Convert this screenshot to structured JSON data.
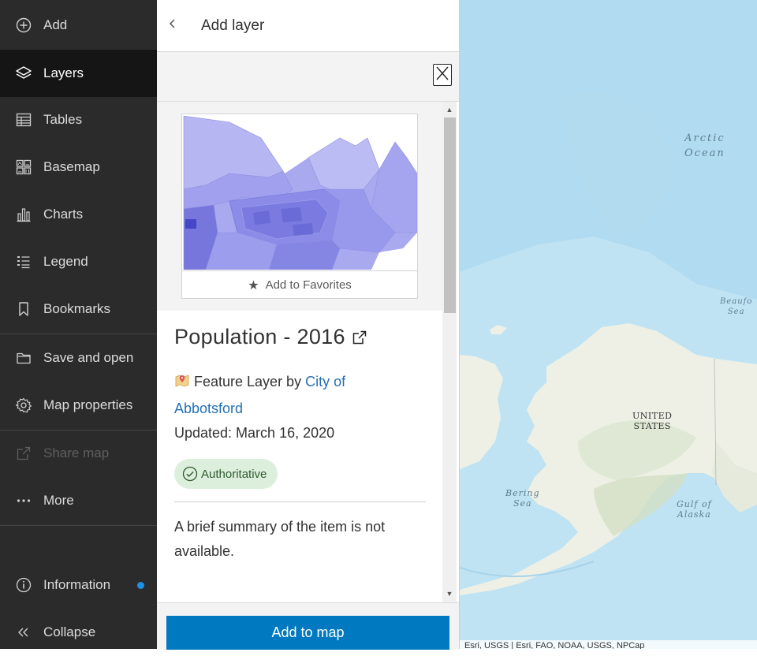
{
  "sidebar": {
    "items": [
      {
        "label": "Add",
        "icon": "plus-circle-icon"
      },
      {
        "label": "Layers",
        "icon": "layers-icon"
      },
      {
        "label": "Tables",
        "icon": "table-icon"
      },
      {
        "label": "Basemap",
        "icon": "basemap-icon"
      },
      {
        "label": "Charts",
        "icon": "chart-icon"
      },
      {
        "label": "Legend",
        "icon": "legend-icon"
      },
      {
        "label": "Bookmarks",
        "icon": "bookmark-icon"
      },
      {
        "label": "Save and open",
        "icon": "folder-icon"
      },
      {
        "label": "Map properties",
        "icon": "gear-icon"
      },
      {
        "label": "Share map",
        "icon": "share-icon"
      },
      {
        "label": "More",
        "icon": "ellipsis-icon"
      },
      {
        "label": "Information",
        "icon": "info-icon"
      },
      {
        "label": "Collapse",
        "icon": "double-chevron-left-icon"
      }
    ],
    "active": "Layers",
    "disabled": "Share map"
  },
  "panel": {
    "title": "Add layer",
    "favorites_label": "Add to Favorites",
    "item_title": "Population - 2016",
    "type_prefix": "Feature Layer by",
    "owner": "City of Abbotsford",
    "updated": "Updated: March 16, 2020",
    "badge": "Authoritative",
    "summary": "A brief summary of the item is not available.",
    "add_button": "Add to map"
  },
  "map": {
    "labels": {
      "arctic_ocean_1": "Arctic",
      "arctic_ocean_2": "Ocean",
      "beaufort_1": "Beaufo",
      "beaufort_2": "Sea",
      "united_states_1": "UNITED",
      "united_states_2": "STATES",
      "bering_1": "Bering",
      "bering_2": "Sea",
      "gulf_1": "Gulf of",
      "gulf_2": "Alaska"
    },
    "attribution": "Esri, USGS | Esri, FAO, NOAA, USGS, NPCap"
  },
  "colors": {
    "sidebar_bg": "#2b2b2b",
    "active_bg": "#151515",
    "accent_blue": "#0079c1",
    "link_blue": "#2470b4",
    "badge_green": "#dcefdc",
    "info_dot": "#1e90e6",
    "ocean": "#bfe3f3",
    "land": "#eef0e6"
  }
}
